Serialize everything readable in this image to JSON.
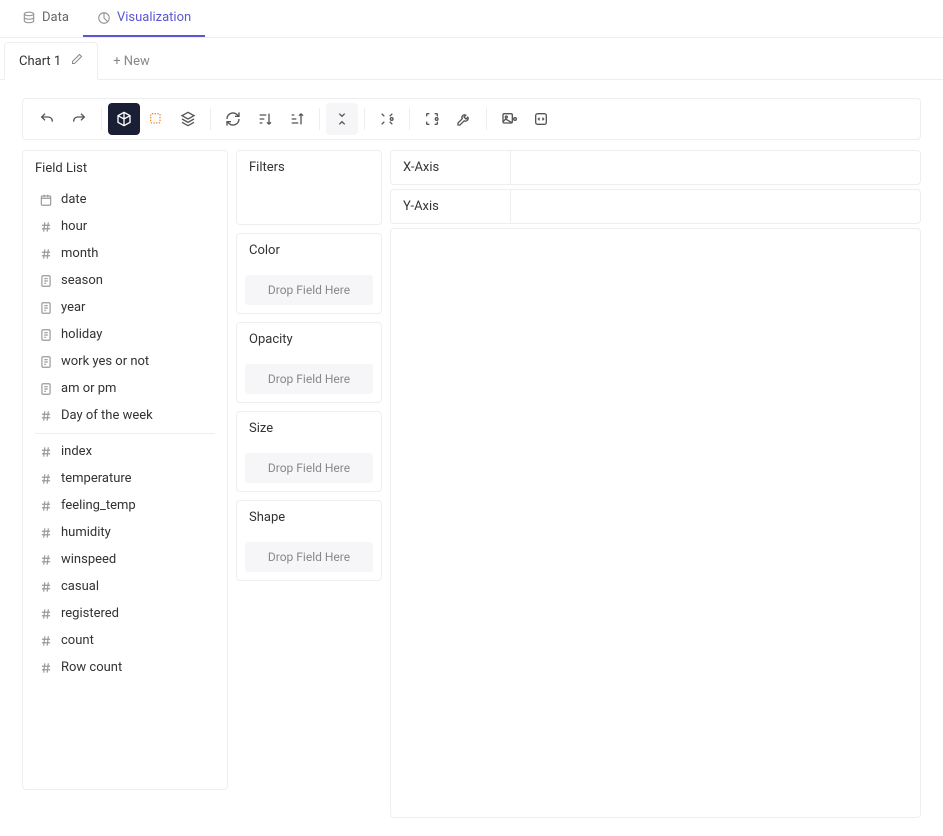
{
  "tabs": {
    "data": "Data",
    "visualization": "Visualization"
  },
  "chartTabs": {
    "chart1": "Chart 1",
    "new": "+ New"
  },
  "panels": {
    "fieldList": "Field List",
    "filters": "Filters",
    "color": "Color",
    "opacity": "Opacity",
    "size": "Size",
    "shape": "Shape",
    "xaxis": "X-Axis",
    "yaxis": "Y-Axis"
  },
  "dropHint": "Drop Field Here",
  "fields": [
    {
      "type": "date",
      "label": "date"
    },
    {
      "type": "number",
      "label": "hour"
    },
    {
      "type": "number",
      "label": "month"
    },
    {
      "type": "text",
      "label": "season"
    },
    {
      "type": "text",
      "label": "year"
    },
    {
      "type": "text",
      "label": "holiday"
    },
    {
      "type": "text",
      "label": "work yes or not"
    },
    {
      "type": "text",
      "label": "am or pm"
    },
    {
      "type": "number",
      "label": "Day of the week"
    },
    {
      "type": "sep"
    },
    {
      "type": "number",
      "label": "index"
    },
    {
      "type": "number",
      "label": "temperature"
    },
    {
      "type": "number",
      "label": "feeling_temp"
    },
    {
      "type": "number",
      "label": "humidity"
    },
    {
      "type": "number",
      "label": "winspeed"
    },
    {
      "type": "number",
      "label": "casual"
    },
    {
      "type": "number",
      "label": "registered"
    },
    {
      "type": "number",
      "label": "count"
    },
    {
      "type": "number",
      "label": "Row count"
    }
  ]
}
